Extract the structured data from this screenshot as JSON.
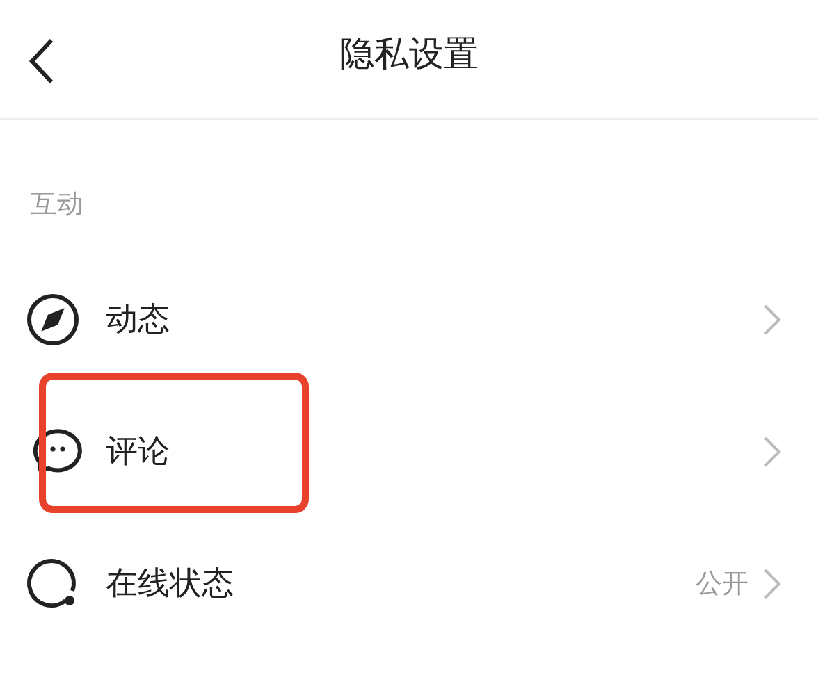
{
  "header": {
    "title": "隐私设置"
  },
  "section": {
    "label": "互动"
  },
  "rows": [
    {
      "kind": "compass",
      "label": "动态",
      "value": null,
      "highlighted": false
    },
    {
      "kind": "comment",
      "label": "评论",
      "value": null,
      "highlighted": true
    },
    {
      "kind": "status",
      "label": "在线状态",
      "value": "公开",
      "highlighted": false
    }
  ]
}
